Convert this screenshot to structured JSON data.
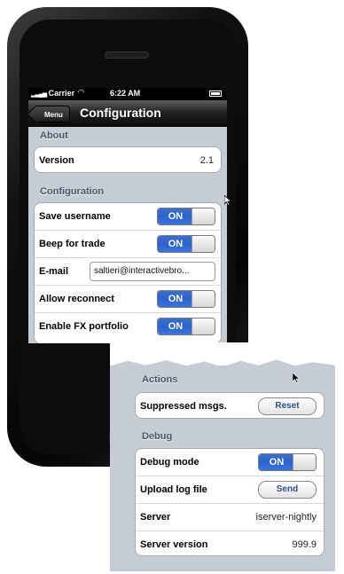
{
  "status_bar": {
    "carrier": "Carrier",
    "time": "6:22 AM",
    "wifi_icon": "wifi-icon",
    "battery_icon": "battery-icon"
  },
  "nav": {
    "back_label": "Menu",
    "title": "Configuration"
  },
  "sections": {
    "about": "About",
    "configuration": "Configuration",
    "actions": "Actions",
    "debug": "Debug"
  },
  "about": {
    "version_label": "Version",
    "version_value": "2.1"
  },
  "configuration": {
    "save_username_label": "Save username",
    "save_username_state": "ON",
    "beep_label": "Beep for trade",
    "beep_state": "ON",
    "email_label": "E-mail",
    "email_value": "saltieri@interactivebro...",
    "allow_reconnect_label": "Allow reconnect",
    "allow_reconnect_state": "ON",
    "fx_label": "Enable FX portfolio",
    "fx_state": "ON"
  },
  "actions": {
    "suppressed_label": "Suppressed msgs.",
    "suppressed_partial": "Suppressed m",
    "reset_label": "Reset"
  },
  "debug": {
    "debug_mode_label": "Debug mode",
    "debug_mode_state": "ON",
    "upload_label": "Upload log file",
    "send_label": "Send",
    "server_label": "Server",
    "server_value": "iserver-nightly",
    "server_version_label": "Server version",
    "server_version_value": "999.9"
  },
  "colors": {
    "toggle_on": "#2b63cf",
    "group_bg": "#c5ccd4",
    "section_text": "#4c566c"
  }
}
